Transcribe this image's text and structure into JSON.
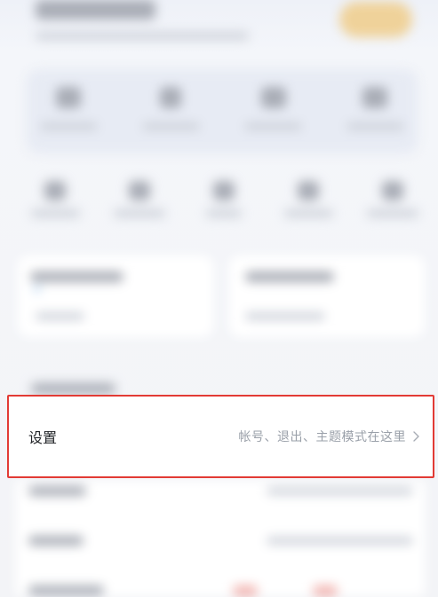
{
  "settings": {
    "title": "设置",
    "subtitle": "帐号、退出、主题模式在这里",
    "chevron_icon": "chevron-right-icon"
  },
  "colors": {
    "highlight_border": "#e23b35",
    "title_text": "#222428",
    "subtitle_text": "#9aa0a9"
  }
}
